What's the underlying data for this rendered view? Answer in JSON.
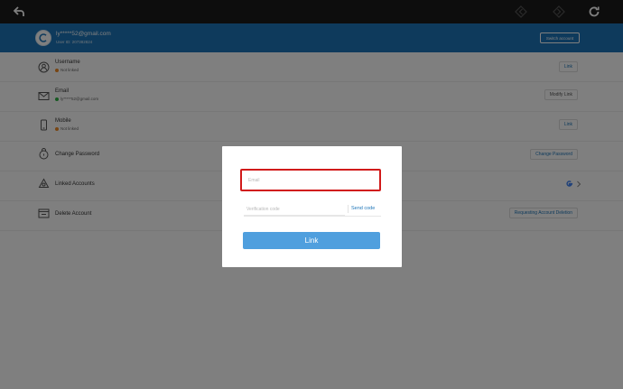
{
  "toolbar": {
    "back_icon": "back-arrow-icon",
    "prev_icon": "prev-diamond-icon",
    "next_icon": "next-diamond-icon",
    "refresh_icon": "refresh-icon"
  },
  "profile": {
    "email": "ly*****52@gmail.com",
    "user_id": "User ID: 207382824",
    "switch_label": "Switch account"
  },
  "rows": [
    {
      "label": "Username",
      "status": "Not linked",
      "status_color": "#f08a24",
      "action": "Link"
    },
    {
      "label": "Email",
      "status": "ly*****52@gmail.com",
      "status_color": "#2fb344",
      "action": "Modify Link"
    },
    {
      "label": "Mobile",
      "status": "Not linked",
      "status_color": "#f08a24",
      "action": "Link"
    },
    {
      "label": "Change Password",
      "action": "Change Password"
    },
    {
      "label": "Linked Accounts"
    },
    {
      "label": "Delete Account",
      "action": "Requesting Account Deletion"
    }
  ],
  "dialog": {
    "email_placeholder": "Email",
    "code_placeholder": "Verification code",
    "send_code": "Send code",
    "link_button": "Link"
  },
  "colors": {
    "accent": "#1d75b8",
    "highlight": "#d11a1a",
    "button": "#4f9fde"
  }
}
